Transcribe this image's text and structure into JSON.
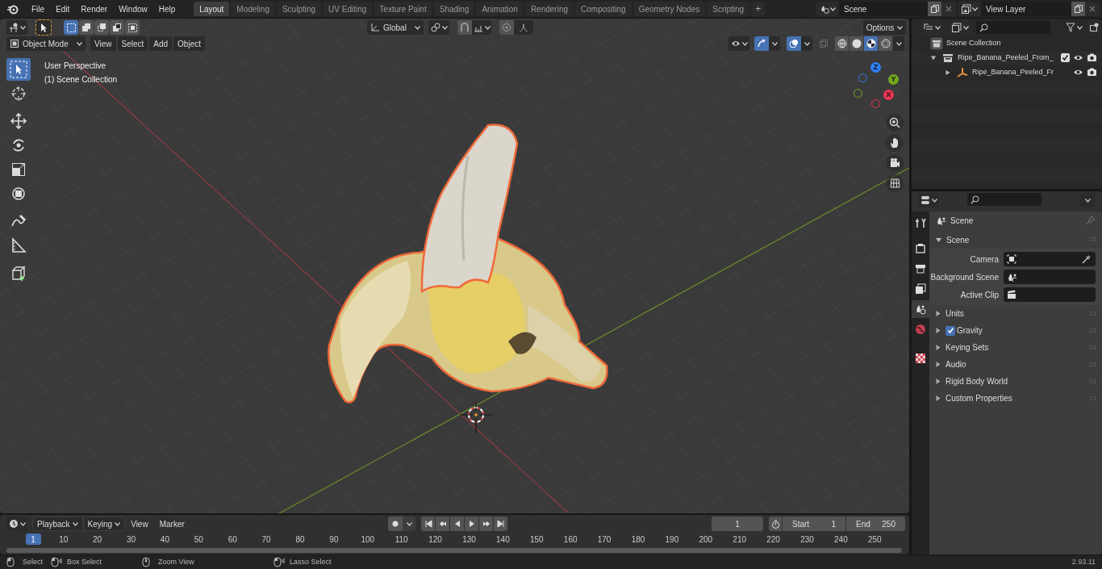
{
  "top_bar": {
    "menus": [
      "File",
      "Edit",
      "Render",
      "Window",
      "Help"
    ],
    "workspace_tabs": [
      {
        "label": "Layout",
        "selected": true
      },
      {
        "label": "Modeling",
        "selected": false
      },
      {
        "label": "Sculpting",
        "selected": false
      },
      {
        "label": "UV Editing",
        "selected": false
      },
      {
        "label": "Texture Paint",
        "selected": false
      },
      {
        "label": "Shading",
        "selected": false
      },
      {
        "label": "Animation",
        "selected": false
      },
      {
        "label": "Rendering",
        "selected": false
      },
      {
        "label": "Compositing",
        "selected": false
      },
      {
        "label": "Geometry Nodes",
        "selected": false
      },
      {
        "label": "Scripting",
        "selected": false
      }
    ],
    "add_tab": "+",
    "scene": "Scene",
    "view_layer": "View Layer"
  },
  "viewport": {
    "select_modes": [
      {
        "selected": true
      },
      {
        "selected": false
      },
      {
        "selected": false
      },
      {
        "selected": false
      },
      {
        "selected": false
      }
    ],
    "orientation": "Global",
    "options": "Options",
    "mode": "Object Mode",
    "menus": [
      "View",
      "Select",
      "Add",
      "Object"
    ],
    "shading_modes": [
      {
        "kind": "wireframe",
        "selected": false
      },
      {
        "kind": "solid",
        "selected": false
      },
      {
        "kind": "material",
        "selected": true
      },
      {
        "kind": "rendered",
        "selected": false
      }
    ],
    "info": [
      "User Perspective",
      "(1) Scene Collection"
    ],
    "tools": [
      {
        "kind": "select",
        "selected": true
      },
      {
        "kind": "cursor",
        "selected": false
      },
      {
        "kind": "move",
        "selected": false
      },
      {
        "kind": "rotate",
        "selected": false
      },
      {
        "kind": "scale",
        "selected": false
      },
      {
        "kind": "transform",
        "selected": false
      },
      {
        "kind": "annotate",
        "selected": false
      },
      {
        "kind": "measure",
        "selected": false
      },
      {
        "kind": "add_cube",
        "selected": false
      }
    ],
    "gizmo_axes": [
      {
        "label": "Z",
        "color": "#2f7ff2"
      },
      {
        "label": "Y",
        "color": "#74a81c"
      },
      {
        "label": "X",
        "color": "#ee3554"
      }
    ]
  },
  "outliner": {
    "items": [
      {
        "label": "Scene Collection",
        "kind": "scene",
        "children": [
          {
            "label": "Ripe_Banana_Peeled_From_",
            "kind": "collection",
            "expanded": true,
            "checked": true,
            "children": [
              {
                "label": "Ripe_Banana_Peeled_Fr",
                "kind": "empty",
                "expanded": false
              }
            ]
          }
        ]
      }
    ]
  },
  "properties": {
    "tabs": [
      {
        "kind": "tool",
        "selected": false
      },
      {
        "kind": "render",
        "selected": false
      },
      {
        "kind": "output",
        "selected": false
      },
      {
        "kind": "view_layer",
        "selected": false
      },
      {
        "kind": "scene",
        "selected": true
      },
      {
        "kind": "world",
        "selected": false
      },
      {
        "kind": "texture",
        "selected": false
      }
    ],
    "context": "Scene",
    "panel": {
      "title": "Scene",
      "expanded": true,
      "fields": [
        {
          "label": "Camera",
          "kind": "camera"
        },
        {
          "label": "Background Scene",
          "kind": "scene"
        },
        {
          "label": "Active Clip",
          "kind": "clip"
        }
      ]
    },
    "sections": [
      {
        "title": "Units",
        "kind": "plain"
      },
      {
        "title": "Gravity",
        "kind": "checkbox",
        "checked": true
      },
      {
        "title": "Keying Sets",
        "kind": "plain"
      },
      {
        "title": "Audio",
        "kind": "plain"
      },
      {
        "title": "Rigid Body World",
        "kind": "plain"
      },
      {
        "title": "Custom Properties",
        "kind": "plain"
      }
    ]
  },
  "timeline": {
    "menus": [
      "Playback",
      "Keying",
      "View",
      "Marker"
    ],
    "current_frame": "1",
    "start_label": "Start",
    "start": "1",
    "end_label": "End",
    "end": "250",
    "ruler": [
      {
        "label": "1",
        "selected": true
      },
      {
        "label": "10",
        "selected": false
      },
      {
        "label": "20",
        "selected": false
      },
      {
        "label": "30",
        "selected": false
      },
      {
        "label": "40",
        "selected": false
      },
      {
        "label": "50",
        "selected": false
      },
      {
        "label": "60",
        "selected": false
      },
      {
        "label": "70",
        "selected": false
      },
      {
        "label": "80",
        "selected": false
      },
      {
        "label": "90",
        "selected": false
      },
      {
        "label": "100",
        "selected": false
      },
      {
        "label": "110",
        "selected": false
      },
      {
        "label": "120",
        "selected": false
      },
      {
        "label": "130",
        "selected": false
      },
      {
        "label": "140",
        "selected": false
      },
      {
        "label": "150",
        "selected": false
      },
      {
        "label": "160",
        "selected": false
      },
      {
        "label": "170",
        "selected": false
      },
      {
        "label": "180",
        "selected": false
      },
      {
        "label": "190",
        "selected": false
      },
      {
        "label": "200",
        "selected": false
      },
      {
        "label": "210",
        "selected": false
      },
      {
        "label": "220",
        "selected": false
      },
      {
        "label": "230",
        "selected": false
      },
      {
        "label": "240",
        "selected": false
      },
      {
        "label": "250",
        "selected": false
      }
    ]
  },
  "status_bar": {
    "hints": [
      {
        "kind": "left",
        "label": "Select"
      },
      {
        "kind": "drag",
        "label": "Box Select"
      },
      {
        "kind": "middle",
        "label": "Zoom View"
      },
      {
        "kind": "drag",
        "label": "Lasso Select"
      }
    ],
    "version": "2.93.11"
  }
}
